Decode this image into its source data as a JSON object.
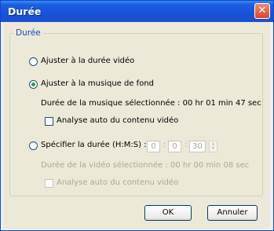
{
  "window": {
    "title": "Durée"
  },
  "group": {
    "legend": "Durée"
  },
  "options": {
    "video_duration": {
      "label": "Ajuster à la durée vidéo",
      "selected": false
    },
    "background_music": {
      "label": "Ajuster à la musique de fond",
      "selected": true,
      "selected_music_duration": "Durée de la musique sélectionnée : 00 hr 01 min 47 sec",
      "auto_analyze_label": "Analyse auto du contenu vidéo",
      "auto_analyze_checked": false
    },
    "specify_duration": {
      "label": "Spécifier la durée (H:M:S) :",
      "selected": false,
      "hours": "0",
      "minutes": "0",
      "seconds": "30",
      "separator": ":",
      "selected_video_duration": "Durée de la vidéo sélectionnée :   00 hr 00 min 08 sec",
      "auto_analyze_label": "Analyse auto du contenu vidéo",
      "auto_analyze_checked": false
    }
  },
  "buttons": {
    "ok": "OK",
    "cancel": "Annuler"
  },
  "icons": {
    "close": "close-icon",
    "spinner_up": "chevron-up-icon",
    "spinner_down": "chevron-down-icon"
  },
  "colors": {
    "titlebar": "#1752d8",
    "legend": "#1646c6",
    "radio_dot": "#2e9f2e",
    "disabled_text": "#aca899"
  }
}
